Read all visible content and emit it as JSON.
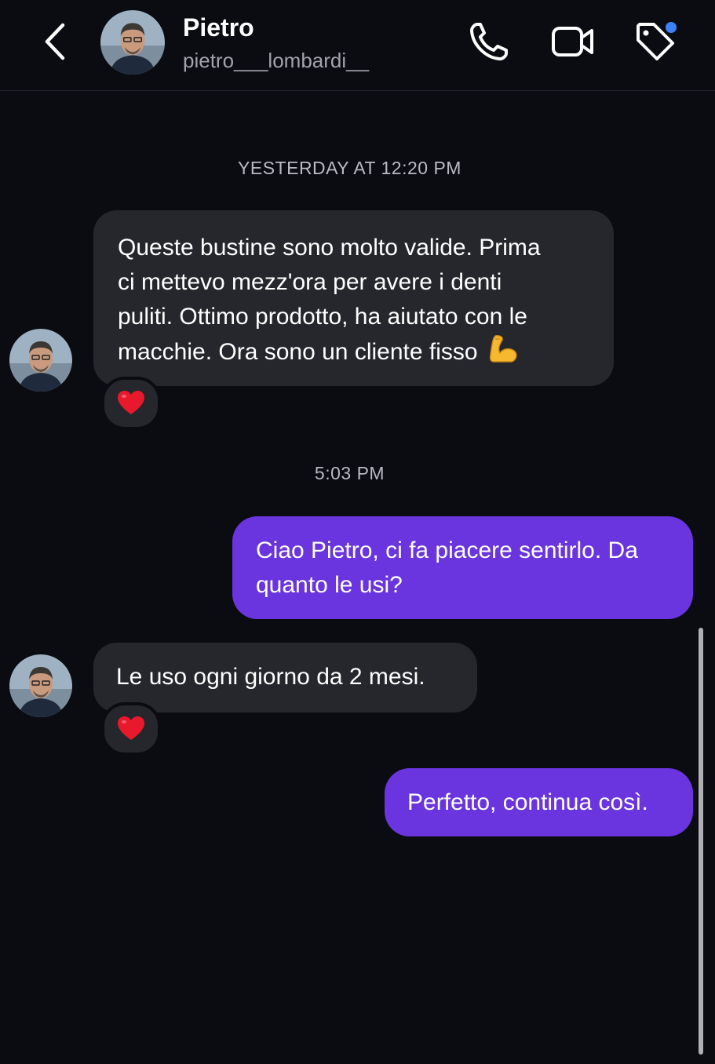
{
  "header": {
    "contact_name": "Pietro",
    "contact_handle": "pietro___lombardi__",
    "icons": [
      "chevron-left-icon",
      "phone-icon",
      "video-camera-icon",
      "tag-icon"
    ],
    "unread_dot_color": "#3b82f6"
  },
  "conversation": {
    "timestamps": [
      "YESTERDAY AT 12:20 PM",
      "5:03 PM"
    ],
    "messages": [
      {
        "direction": "incoming",
        "lines": [
          "Queste bustine sono molto valide. Prima",
          "ci mettevo mezz'ora per avere i denti",
          "puliti. Ottimo prodotto, ha aiutato con le",
          "macchie. Ora sono un cliente fisso"
        ],
        "emoji": "💪",
        "reaction": "❤️"
      },
      {
        "direction": "outgoing",
        "lines": [
          "Ciao Pietro, ci fa piacere sentirlo. Da",
          "quanto le usi?"
        ]
      },
      {
        "direction": "incoming",
        "lines": [
          "Le uso ogni giorno da 2 mesi."
        ],
        "reaction": "❤️"
      },
      {
        "direction": "outgoing",
        "lines": [
          "Perfetto, continua così."
        ]
      }
    ]
  },
  "colors": {
    "background": "#0b0c12",
    "incoming_bubble": "#26272d",
    "outgoing_bubble": "#6a34de",
    "reaction_heart": "#e8192c"
  }
}
